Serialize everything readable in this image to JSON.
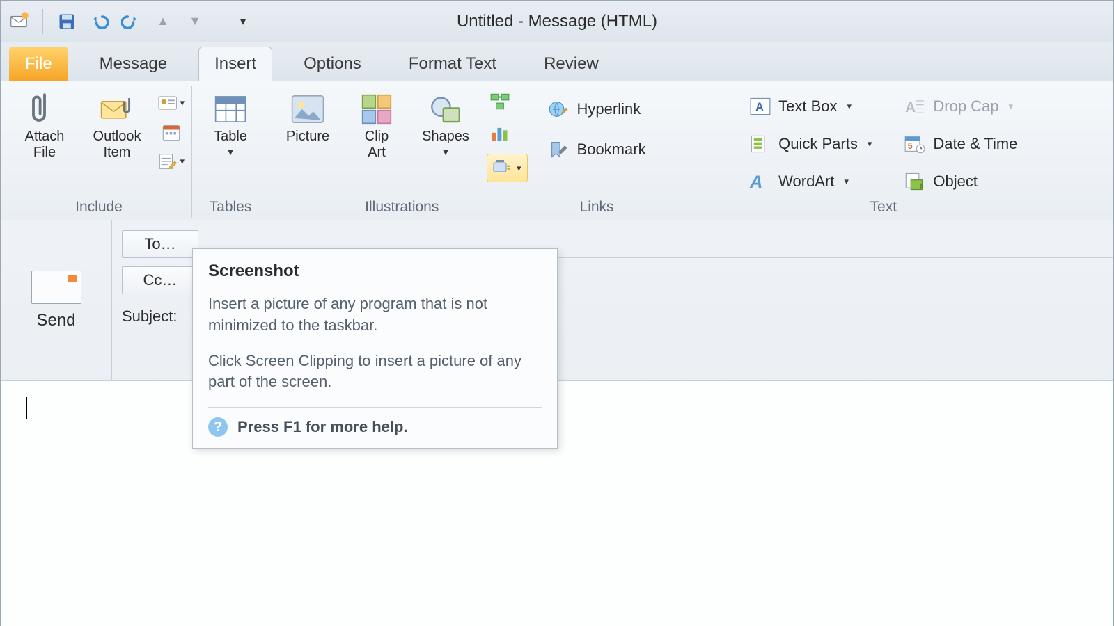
{
  "title": "Untitled - Message (HTML)",
  "tabs": [
    "File",
    "Message",
    "Insert",
    "Options",
    "Format Text",
    "Review"
  ],
  "ribbon": {
    "include": {
      "label": "Include",
      "attach_file": "Attach\nFile",
      "outlook_item": "Outlook\nItem"
    },
    "tables": {
      "label": "Tables",
      "table": "Table"
    },
    "illustrations": {
      "label": "Illustrations",
      "picture": "Picture",
      "clip_art": "Clip\nArt",
      "shapes": "Shapes"
    },
    "links": {
      "label": "Links",
      "hyperlink": "Hyperlink",
      "bookmark": "Bookmark"
    },
    "text": {
      "label": "Text",
      "text_box": "Text Box",
      "quick_parts": "Quick Parts",
      "wordart": "WordArt",
      "drop_cap": "Drop Cap",
      "date_time": "Date & Time",
      "object": "Object"
    }
  },
  "compose": {
    "send": "Send",
    "to": "To…",
    "cc": "Cc…",
    "subject": "Subject:"
  },
  "tooltip": {
    "title": "Screenshot",
    "p1": "Insert a picture of any program that is not minimized to the taskbar.",
    "p2": "Click Screen Clipping to insert a picture of any part of the screen.",
    "help": "Press F1 for more help."
  }
}
